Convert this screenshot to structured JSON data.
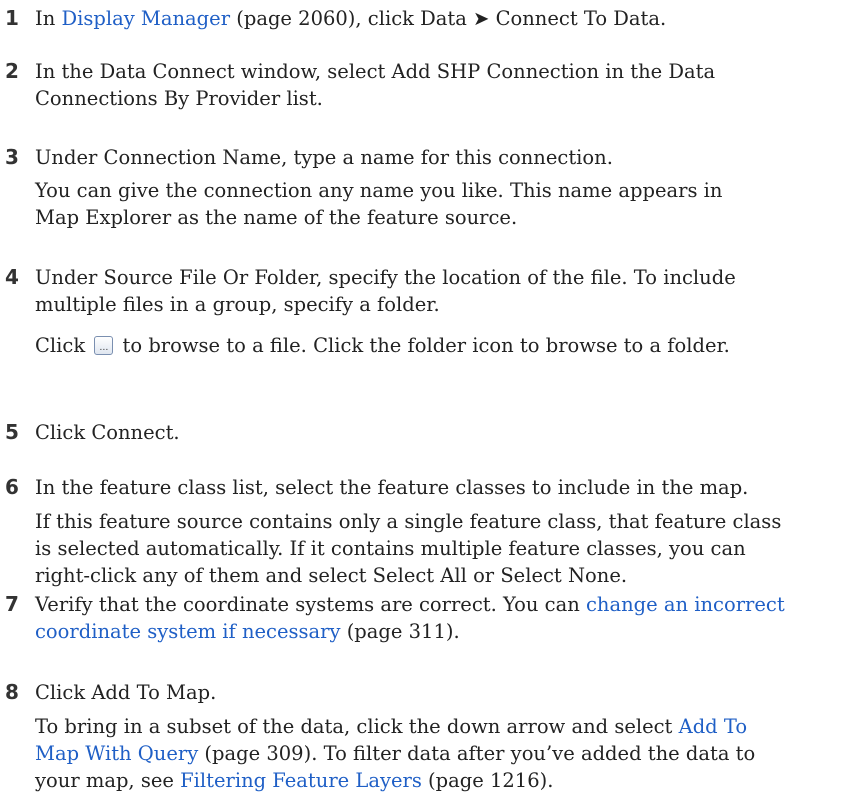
{
  "steps": [
    {
      "number": "1",
      "lines": [
        [
          {
            "text": "In ",
            "link": false
          },
          {
            "text": "Display Manager",
            "link": true
          },
          {
            "text": " (page 2060), click Data ➤ Connect To Data.",
            "link": false
          }
        ]
      ]
    },
    {
      "number": "2",
      "lines": [
        [
          {
            "text": "In the Data Connect window, select Add SHP Connection in the Data",
            "link": false
          }
        ],
        [
          {
            "text": "Connections By Provider list.",
            "link": false
          }
        ]
      ]
    },
    {
      "number": "3",
      "lines": [
        [
          {
            "text": "Under Connection Name, type a name for this connection.",
            "link": false
          }
        ],
        [
          {
            "text": "You can give the connection any name you like. This name appears in",
            "link": false
          }
        ],
        [
          {
            "text": "Map Explorer as the name of the feature source.",
            "link": false
          }
        ]
      ]
    },
    {
      "number": "4",
      "lines": [
        [
          {
            "text": "Under Source File Or Folder, specify the location of the file. To include",
            "link": false
          }
        ],
        [
          {
            "text": "multiple files in a group, specify a folder.",
            "link": false
          }
        ],
        [
          {
            "text": "Click ",
            "link": false
          },
          {
            "icon": "browse-button-icon",
            "glyph": "…"
          },
          {
            "text": " to browse to a file. Click the folder icon to browse to a folder.",
            "link": false
          }
        ]
      ]
    },
    {
      "number": "5",
      "lines": [
        [
          {
            "text": "Click Connect.",
            "link": false
          }
        ]
      ]
    },
    {
      "number": "6",
      "lines": [
        [
          {
            "text": "In the feature class list, select the feature classes to include in the map.",
            "link": false
          }
        ],
        [
          {
            "text": "If this feature source contains only a single feature class, that feature class",
            "link": false
          }
        ],
        [
          {
            "text": "is selected automatically. If it contains multiple feature classes, you can",
            "link": false
          }
        ],
        [
          {
            "text": "right-click any of them and select Select All or Select None.",
            "link": false
          }
        ]
      ]
    },
    {
      "number": "7",
      "lines": [
        [
          {
            "text": "Verify that the coordinate systems are correct. You can ",
            "link": false
          },
          {
            "text": "change an incorrect",
            "link": true
          }
        ],
        [
          {
            "text": "coordinate system if necessary",
            "link": true
          },
          {
            "text": " (page 311).",
            "link": false
          }
        ]
      ]
    },
    {
      "number": "8",
      "lines": [
        [
          {
            "text": "Click Add To Map.",
            "link": false
          }
        ],
        [
          {
            "text": "To bring in a subset of the data, click the down arrow and select ",
            "link": false
          },
          {
            "text": "Add To",
            "link": true
          }
        ],
        [
          {
            "text": "Map With Query",
            "link": true
          },
          {
            "text": " (page 309). To filter data after you’ve added the data to",
            "link": false
          }
        ],
        [
          {
            "text": "your map, see ",
            "link": false
          },
          {
            "text": "Filtering Feature Layers",
            "link": true
          },
          {
            "text": " (page 1216).",
            "link": false
          }
        ]
      ]
    }
  ],
  "colors": {
    "link": "#1f5fc6",
    "text": "#222222"
  }
}
